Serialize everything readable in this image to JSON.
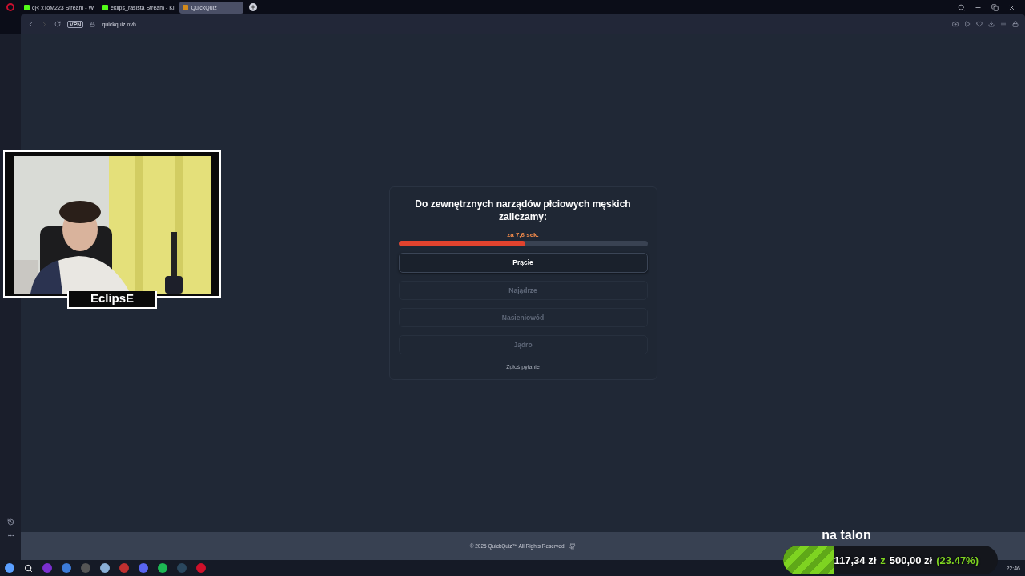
{
  "browser": {
    "tabs": [
      {
        "title": "c|< xToM223 Stream - W",
        "kind": "kick",
        "selected": false
      },
      {
        "title": "eklips_rasista Stream - Ki",
        "kind": "kick",
        "selected": false
      },
      {
        "title": "QuickQuiz",
        "kind": "quiz",
        "selected": true
      }
    ],
    "vpn": "VPN",
    "url": "quickquiz.ovh"
  },
  "quiz": {
    "question": "Do zewnętrznych narządów płciowych męskich zaliczamy:",
    "timer": "za 7,6 sek.",
    "level": 0.51,
    "answers": [
      {
        "label": "Prącie",
        "selected": true
      },
      {
        "label": "Najądrze",
        "selected": false
      },
      {
        "label": "Nasieniowód",
        "selected": false
      },
      {
        "label": "Jądro",
        "selected": false
      }
    ],
    "report": "Zgłoś pytanie"
  },
  "footer": {
    "text": "© 2025  QuickQuiz™ All Rights Reserved."
  },
  "webcam": {
    "name": "EclipsE"
  },
  "goal": {
    "title": "na talon",
    "current": "117,34 zł",
    "separator": "z",
    "target": "500,00 zł",
    "percent": "(23.47%)",
    "level": 0.2347
  },
  "taskbar": {
    "clock": "22:46"
  }
}
